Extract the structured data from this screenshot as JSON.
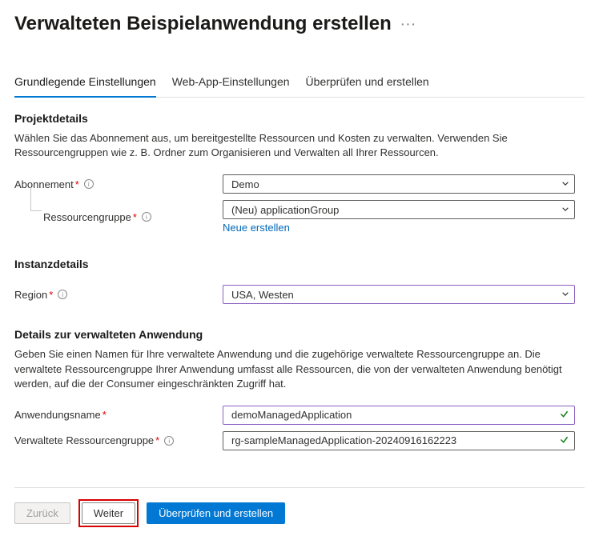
{
  "header": {
    "title": "Verwalteten Beispielanwendung erstellen"
  },
  "tabs": {
    "basic": "Grundlegende Einstellungen",
    "webapp": "Web-App-Einstellungen",
    "review": "Überprüfen und erstellen"
  },
  "section_project": {
    "heading": "Projektdetails",
    "description": "Wählen Sie das Abonnement aus, um bereitgestellte Ressourcen und Kosten zu verwalten. Verwenden Sie Ressourcengruppen wie z. B. Ordner zum Organisieren und Verwalten all Ihrer Ressourcen."
  },
  "fields": {
    "subscription_label": "Abonnement",
    "subscription_value": "Demo",
    "resourcegroup_label": "Ressourcengruppe",
    "resourcegroup_value": "(Neu) applicationGroup",
    "resourcegroup_new_link": "Neue erstellen"
  },
  "section_instance": {
    "heading": "Instanzdetails",
    "region_label": "Region",
    "region_value": "USA, Westen"
  },
  "section_managed": {
    "heading": "Details zur verwalteten Anwendung",
    "description": "Geben Sie einen Namen für Ihre verwaltete Anwendung und die zugehörige verwaltete Ressourcengruppe an. Die verwaltete Ressourcengruppe Ihrer Anwendung umfasst alle Ressourcen, die von der verwalteten Anwendung benötigt werden, auf die der Consumer eingeschränkten Zugriff hat.",
    "appname_label": "Anwendungsname",
    "appname_value": "demoManagedApplication",
    "managed_rg_label": "Verwaltete Ressourcengruppe",
    "managed_rg_value": "rg-sampleManagedApplication-20240916162223"
  },
  "footer": {
    "back": "Zurück",
    "next": "Weiter",
    "review": "Überprüfen und erstellen"
  }
}
